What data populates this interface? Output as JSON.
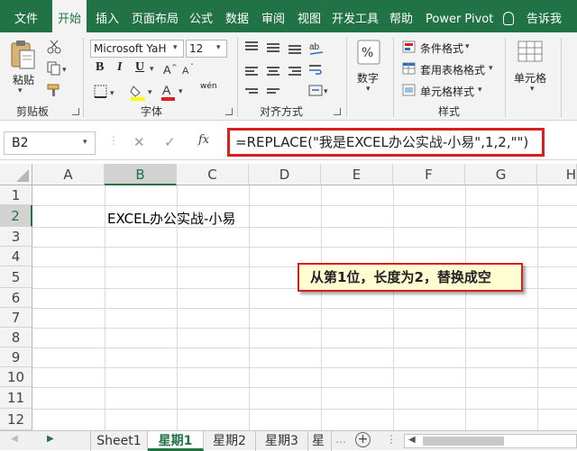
{
  "menu_tabs": [
    "文件",
    "开始",
    "插入",
    "页面布局",
    "公式",
    "数据",
    "审阅",
    "视图",
    "开发工具",
    "帮助",
    "Power Pivot",
    "告诉我"
  ],
  "ribbon": {
    "paste_label": "粘贴",
    "clipboard_label": "剪贴板",
    "font_name": "Microsoft YaH",
    "font_size": "12",
    "bold": "B",
    "italic": "I",
    "underline": "U",
    "font_group_label": "字体",
    "phonetic_label": "wén",
    "align_group_label": "对齐方式",
    "number_label": "数字",
    "conditional_format": "条件格式",
    "table_format": "套用表格格式",
    "cell_style": "单元格样式",
    "style_group_label": "样式",
    "cells_label": "单元格",
    "colors": {
      "brand": "#217346",
      "highlight": "#ffff00",
      "font_color": "#d9201f"
    }
  },
  "formula_bar": {
    "name_box": "B2",
    "cancel": "✕",
    "enter": "✓",
    "fx": "fx",
    "formula": "=REPLACE(\"我是EXCEL办公实战-小易\",1,2,\"\")"
  },
  "grid": {
    "columns": [
      "A",
      "B",
      "C",
      "D",
      "E",
      "F",
      "G",
      "H"
    ],
    "rows": [
      "1",
      "2",
      "3",
      "4",
      "5",
      "6",
      "7",
      "8",
      "9",
      "10",
      "11",
      "12"
    ],
    "cell_b2": "EXCEL办公实战-小易",
    "callout": "从第1位，长度为2，替换成空"
  },
  "sheet_tabs": [
    "Sheet1",
    "星期1",
    "星期2",
    "星期3",
    "星"
  ],
  "active_sheet": "星期1"
}
